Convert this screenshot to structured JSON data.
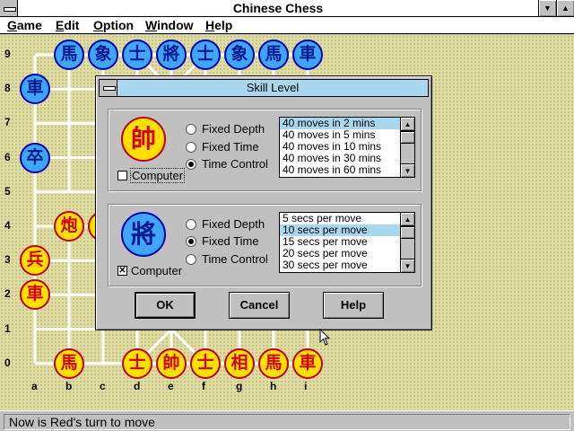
{
  "window": {
    "title": "Chinese Chess",
    "minimize_glyph": "▼",
    "maximize_glyph": "▲"
  },
  "menu": [
    {
      "label": "Game",
      "mnemonic": "G",
      "rest": "ame"
    },
    {
      "label": "Edit",
      "mnemonic": "E",
      "rest": "dit"
    },
    {
      "label": "Option",
      "mnemonic": "O",
      "rest": "ption"
    },
    {
      "label": "Window",
      "mnemonic": "W",
      "rest": "indow"
    },
    {
      "label": "Help",
      "mnemonic": "H",
      "rest": "elp"
    }
  ],
  "board": {
    "rank_labels": [
      "9",
      "8",
      "7",
      "6",
      "5",
      "4",
      "3",
      "2",
      "1",
      "0"
    ],
    "file_labels": [
      "a",
      "b",
      "c",
      "d",
      "e",
      "f",
      "g",
      "h",
      "i"
    ],
    "pieces": [
      {
        "side": "blue",
        "char": "馬",
        "file": "b",
        "rank": "9"
      },
      {
        "side": "blue",
        "char": "象",
        "file": "c",
        "rank": "9"
      },
      {
        "side": "blue",
        "char": "士",
        "file": "d",
        "rank": "9"
      },
      {
        "side": "blue",
        "char": "將",
        "file": "e",
        "rank": "9"
      },
      {
        "side": "blue",
        "char": "士",
        "file": "f",
        "rank": "9"
      },
      {
        "side": "blue",
        "char": "象",
        "file": "g",
        "rank": "9"
      },
      {
        "side": "blue",
        "char": "馬",
        "file": "h",
        "rank": "9"
      },
      {
        "side": "blue",
        "char": "車",
        "file": "i",
        "rank": "9"
      },
      {
        "side": "blue",
        "char": "車",
        "file": "a",
        "rank": "8"
      },
      {
        "side": "blue",
        "char": "卒",
        "file": "a",
        "rank": "6"
      },
      {
        "side": "red",
        "char": "炮",
        "file": "b",
        "rank": "4"
      },
      {
        "side": "red",
        "char": "炮",
        "file": "c",
        "rank": "4"
      },
      {
        "side": "red",
        "char": "兵",
        "file": "a",
        "rank": "3"
      },
      {
        "side": "red",
        "char": "車",
        "file": "a",
        "rank": "2"
      },
      {
        "side": "red",
        "char": "馬",
        "file": "b",
        "rank": "0"
      },
      {
        "side": "red",
        "char": "士",
        "file": "d",
        "rank": "0"
      },
      {
        "side": "red",
        "char": "帥",
        "file": "e",
        "rank": "0"
      },
      {
        "side": "red",
        "char": "士",
        "file": "f",
        "rank": "0"
      },
      {
        "side": "red",
        "char": "相",
        "file": "g",
        "rank": "0"
      },
      {
        "side": "red",
        "char": "馬",
        "file": "h",
        "rank": "0"
      },
      {
        "side": "red",
        "char": "車",
        "file": "i",
        "rank": "0"
      }
    ]
  },
  "status": {
    "text": "Now is Red's turn to move"
  },
  "dialog": {
    "title": "Skill Level",
    "red_panel": {
      "emblem": "帥",
      "emblem_color": "#ffe000",
      "computer_label": "Computer",
      "computer_checked": false,
      "check_mark": "",
      "options": [
        "Fixed Depth",
        "Fixed Time",
        "Time Control"
      ],
      "selected_option": "Time Control",
      "list": [
        "40 moves in 2 mins",
        "40 moves in 5 mins",
        "40 moves in 10 mins",
        "40 moves in 30 mins",
        "40 moves in 60 mins"
      ],
      "selected_item": "40 moves in 2 mins"
    },
    "blue_panel": {
      "emblem": "將",
      "emblem_color": "#3ea6ff",
      "computer_label": "Computer",
      "computer_checked": true,
      "check_mark": "✕",
      "options": [
        "Fixed Depth",
        "Fixed Time",
        "Time Control"
      ],
      "selected_option": "Fixed Time",
      "list": [
        "5 secs per move",
        "10 secs per move",
        "15 secs per move",
        "20 secs per move",
        "30 secs per move"
      ],
      "selected_item": "10 secs per move"
    },
    "buttons": {
      "ok": "OK",
      "cancel": "Cancel",
      "help": "Help"
    },
    "scroll_up_glyph": "▲",
    "scroll_down_glyph": "▼"
  }
}
